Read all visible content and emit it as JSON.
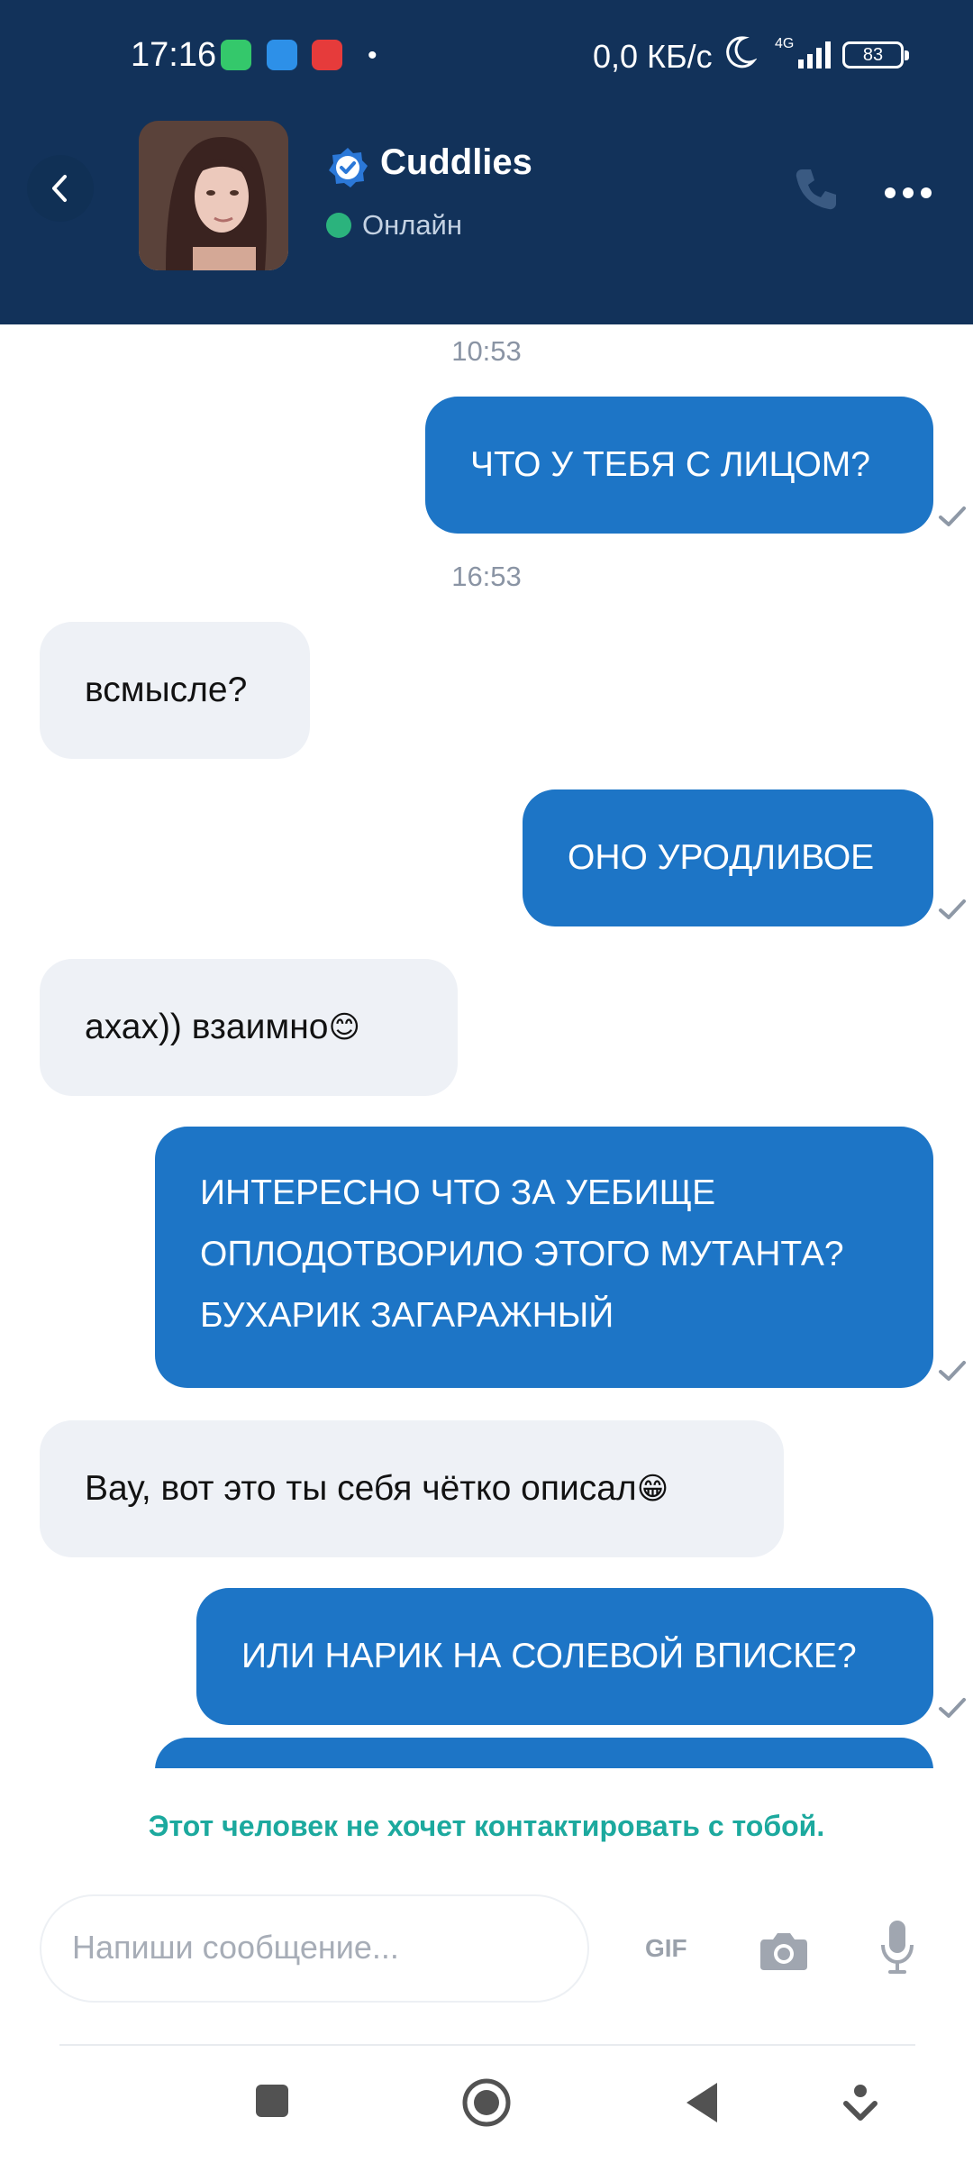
{
  "status_bar": {
    "time": "17:16",
    "net_speed": "0,0 КБ/с",
    "network_type": "4G",
    "battery": "83",
    "app_icons": [
      "mi-icon",
      "messages-icon",
      "dating-app-icon"
    ],
    "app_colors": [
      "#34c86b",
      "#2d90e8",
      "#e63b3b"
    ]
  },
  "header": {
    "name": "Cuddlies",
    "status": "Онлайн",
    "verified": true,
    "icons": {
      "back": "chevron-left-icon",
      "phone": "phone-icon",
      "menu": "more-horizontal-icon"
    }
  },
  "chat": {
    "timestamps": [
      "10:53",
      "16:53"
    ],
    "messages": [
      {
        "direction": "out",
        "text": "ЧТО У ТЕБЯ С ЛИЦОМ?"
      },
      {
        "direction": "in",
        "text": "всмысле?"
      },
      {
        "direction": "out",
        "text": "ОНО УРОДЛИВОЕ"
      },
      {
        "direction": "in",
        "text": "ахах)) взаимно",
        "emoji": "😊"
      },
      {
        "direction": "out",
        "lines": [
          "ИНТЕРЕСНО ЧТО ЗА УЕБИЩЕ",
          "ОПЛОДОТВОРИЛО ЭТОГО МУТАНТА?",
          "БУХАРИК ЗАГАРАЖНЫЙ"
        ]
      },
      {
        "direction": "in",
        "text": "Вау, вот это ты себя чётко описал",
        "emoji": "😁"
      },
      {
        "direction": "out",
        "text": "ИЛИ НАРИК НА СОЛЕВОЙ ВПИСКЕ?"
      }
    ]
  },
  "blocked_notice": "Этот человек не хочет контактировать с тобой.",
  "composer": {
    "placeholder": "Напиши сообщение...",
    "gif_label": "GIF"
  },
  "colors": {
    "header_bg": "#12325a",
    "outgoing_bubble": "#1d75c6",
    "incoming_bubble": "#eef1f6",
    "online": "#2bb37d",
    "notice": "#1ca99e"
  }
}
